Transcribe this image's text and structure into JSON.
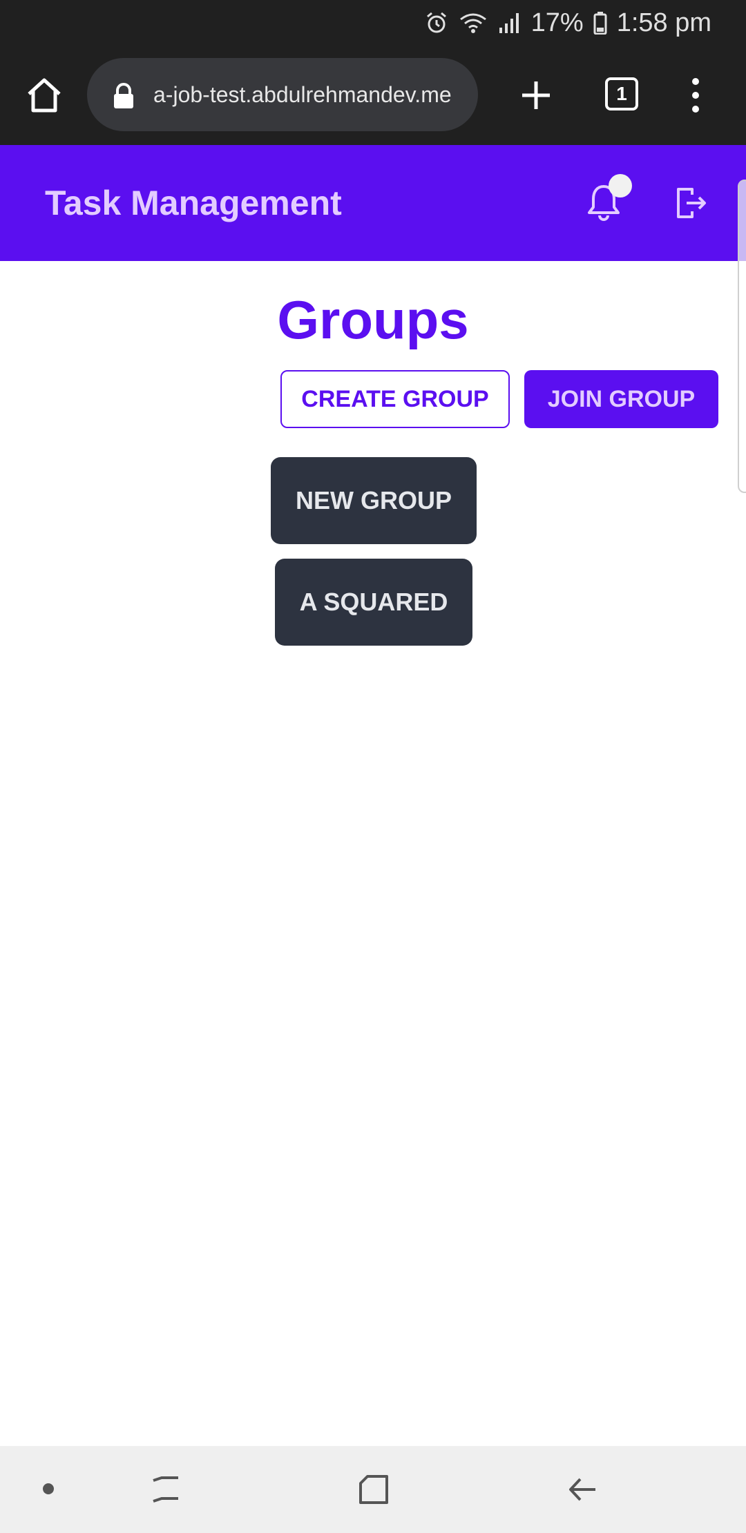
{
  "status_bar": {
    "battery": "17%",
    "time": "1:58 pm",
    "icons": [
      "alarm-icon",
      "wifi-icon",
      "signal-icon",
      "battery-icon"
    ]
  },
  "browser": {
    "url": "a-job-test.abdulrehmandev.me",
    "tab_count": "1",
    "icons": [
      "home-icon",
      "lock-icon",
      "plus-icon",
      "tabs-icon",
      "more-vert-icon"
    ]
  },
  "app": {
    "title": "Task Management",
    "icons": [
      "bell-icon",
      "logout-icon"
    ],
    "accent_color": "#5b0ff0"
  },
  "main": {
    "heading": "Groups",
    "create_group_label": "CREATE GROUP",
    "join_group_label": "JOIN GROUP",
    "groups": [
      {
        "name": "NEW GROUP"
      },
      {
        "name": "A SQUARED"
      }
    ],
    "card_color": "#2d3340"
  },
  "nav_bar": {
    "icons": [
      "dot-icon",
      "recents-icon",
      "home-square-icon",
      "back-icon"
    ]
  }
}
